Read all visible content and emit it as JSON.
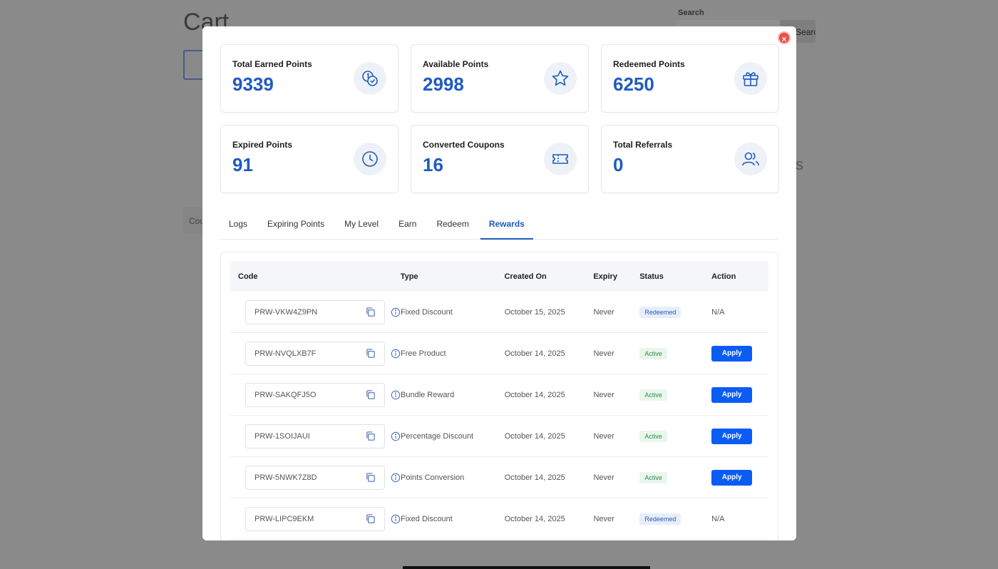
{
  "background": {
    "page_title": "Cart",
    "search_label": "Search",
    "search_button": "Search",
    "coupon_text": "Cou",
    "side_letter": "s"
  },
  "modal": {
    "close_label": "×",
    "stats": [
      {
        "label": "Total Earned Points",
        "value": "9339",
        "icon": "coins-icon"
      },
      {
        "label": "Available Points",
        "value": "2998",
        "icon": "star-icon"
      },
      {
        "label": "Redeemed Points",
        "value": "6250",
        "icon": "gift-icon"
      },
      {
        "label": "Expired Points",
        "value": "91",
        "icon": "clock-icon"
      },
      {
        "label": "Converted Coupons",
        "value": "16",
        "icon": "ticket-icon"
      },
      {
        "label": "Total Referrals",
        "value": "0",
        "icon": "users-icon"
      }
    ],
    "tabs": [
      {
        "label": "Logs",
        "active": false
      },
      {
        "label": "Expiring Points",
        "active": false
      },
      {
        "label": "My Level",
        "active": false
      },
      {
        "label": "Earn",
        "active": false
      },
      {
        "label": "Redeem",
        "active": false
      },
      {
        "label": "Rewards",
        "active": true
      }
    ],
    "table": {
      "headers": {
        "code": "Code",
        "type": "Type",
        "created": "Created On",
        "expiry": "Expiry",
        "status": "Status",
        "action": "Action"
      },
      "rows": [
        {
          "code": "PRW-VKW4Z9PN",
          "type": "Fixed Discount",
          "created": "October 15, 2025",
          "expiry": "Never",
          "status": "Redeemed",
          "action": "N/A"
        },
        {
          "code": "PRW-NVQLXB7F",
          "type": "Free Product",
          "created": "October 14, 2025",
          "expiry": "Never",
          "status": "Active",
          "action": "Apply"
        },
        {
          "code": "PRW-SAKQFJ5O",
          "type": "Bundle Reward",
          "created": "October 14, 2025",
          "expiry": "Never",
          "status": "Active",
          "action": "Apply"
        },
        {
          "code": "PRW-1SOIJAUI",
          "type": "Percentage Discount",
          "created": "October 14, 2025",
          "expiry": "Never",
          "status": "Active",
          "action": "Apply"
        },
        {
          "code": "PRW-5NWK7Z8D",
          "type": "Points Conversion",
          "created": "October 14, 2025",
          "expiry": "Never",
          "status": "Active",
          "action": "Apply"
        },
        {
          "code": "PRW-LIPC9EKM",
          "type": "Fixed Discount",
          "created": "October 14, 2025",
          "expiry": "Never",
          "status": "Redeemed",
          "action": "N/A"
        }
      ]
    }
  },
  "colors": {
    "accent": "#1e5bbf",
    "apply_button": "#0a5cf5",
    "close": "#e8504a"
  }
}
